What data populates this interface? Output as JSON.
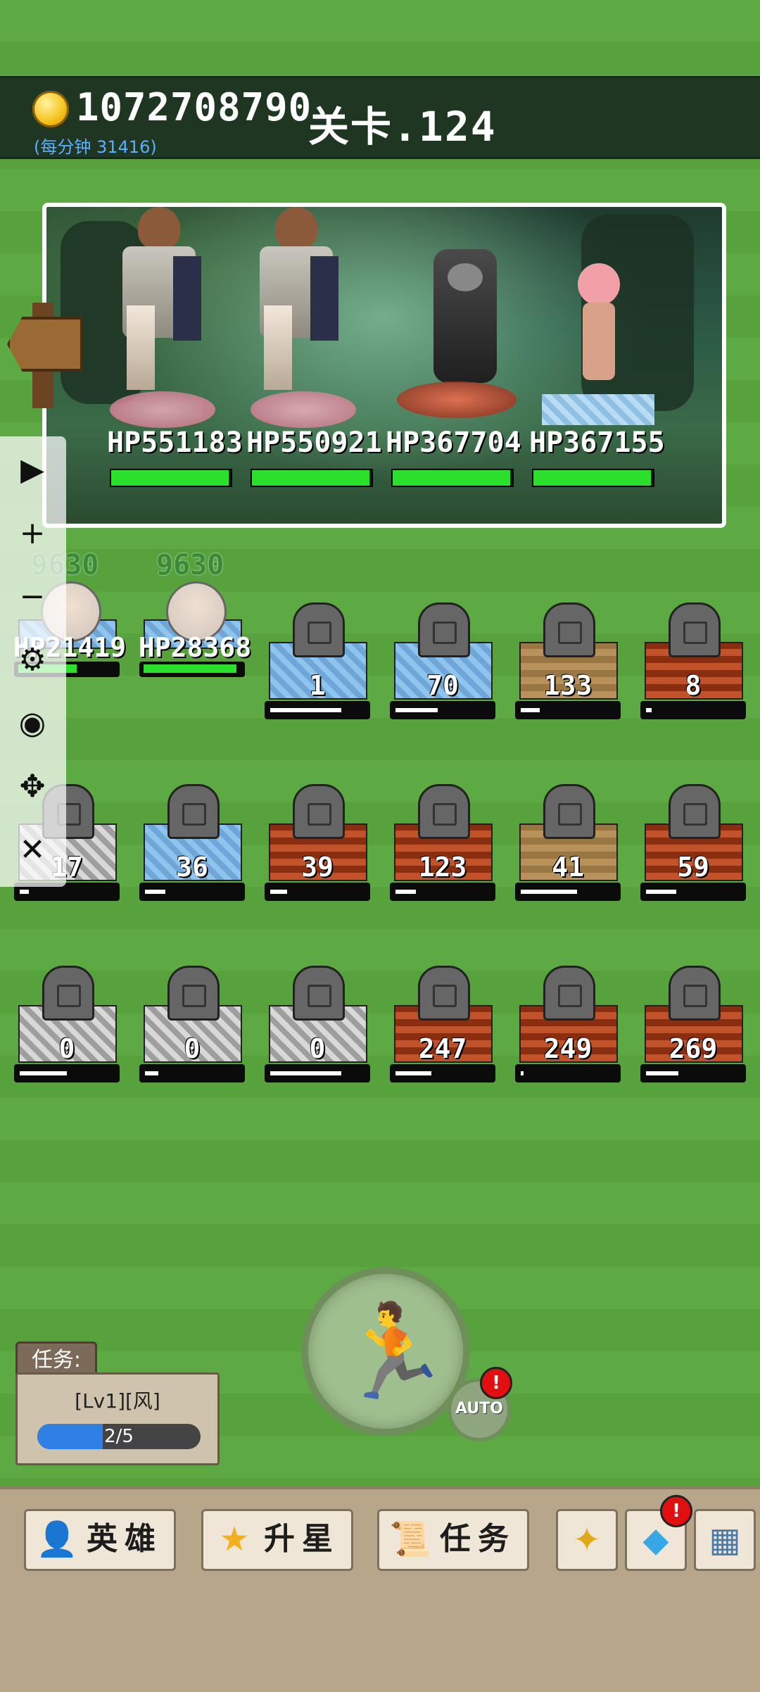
{
  "header": {
    "gold": "1072708790",
    "rate": "(每分钟 31416)",
    "stage": "关卡.124"
  },
  "battle": {
    "enemies": [
      {
        "hp_label": "HP551183",
        "hp_fraction": 0.98
      },
      {
        "hp_label": "HP550921",
        "hp_fraction": 0.98
      },
      {
        "hp_label": "HP367704",
        "hp_fraction": 0.98
      },
      {
        "hp_label": "HP367155",
        "hp_fraction": 0.98
      }
    ]
  },
  "sidebar": {
    "icons": [
      "play-icon",
      "plus-icon",
      "minus-icon",
      "gear-icon",
      "eye-icon",
      "move-icon",
      "close-icon"
    ]
  },
  "heroes": [
    {
      "damage": "9630",
      "hp": "HP21419",
      "hp_fraction": 0.6
    },
    {
      "damage": "9630",
      "hp": "HP28368",
      "hp_fraction": 0.96
    }
  ],
  "grid": [
    {
      "value": "1",
      "pad": "ice",
      "progress": 0.75
    },
    {
      "value": "70",
      "pad": "ice",
      "progress": 0.45
    },
    {
      "value": "133",
      "pad": "wood",
      "progress": 0.2
    },
    {
      "value": "8",
      "pad": "lava",
      "progress": 0.06
    },
    {
      "value": "17",
      "pad": "rock",
      "progress": 0.1
    },
    {
      "value": "36",
      "pad": "ice",
      "progress": 0.22
    },
    {
      "value": "39",
      "pad": "lava",
      "progress": 0.18
    },
    {
      "value": "123",
      "pad": "lava",
      "progress": 0.22
    },
    {
      "value": "41",
      "pad": "wood",
      "progress": 0.6
    },
    {
      "value": "59",
      "pad": "lava",
      "progress": 0.32
    },
    {
      "value": "0",
      "pad": "rock",
      "progress": 0.5
    },
    {
      "value": "0",
      "pad": "rock",
      "progress": 0.14
    },
    {
      "value": "0",
      "pad": "rock",
      "progress": 0.75
    },
    {
      "value": "247",
      "pad": "lava",
      "progress": 0.38
    },
    {
      "value": "249",
      "pad": "lava",
      "progress": 0.03
    },
    {
      "value": "269",
      "pad": "lava",
      "progress": 0.34
    }
  ],
  "actions": {
    "auto_label": "AUTO",
    "auto_badge": "!"
  },
  "task": {
    "title": "任务:",
    "level": "[Lv1][风]",
    "progress_label": "2/5",
    "progress_fraction": 0.4
  },
  "nav": {
    "hero_label": "英雄",
    "star_label": "升星",
    "quest_label": "任务",
    "shop_badge": "!"
  },
  "colors": {
    "background": "#5aa73f",
    "hp_green": "#2be02b",
    "progress_blue": "#2f7fe6",
    "badge_red": "#e10f0f"
  }
}
